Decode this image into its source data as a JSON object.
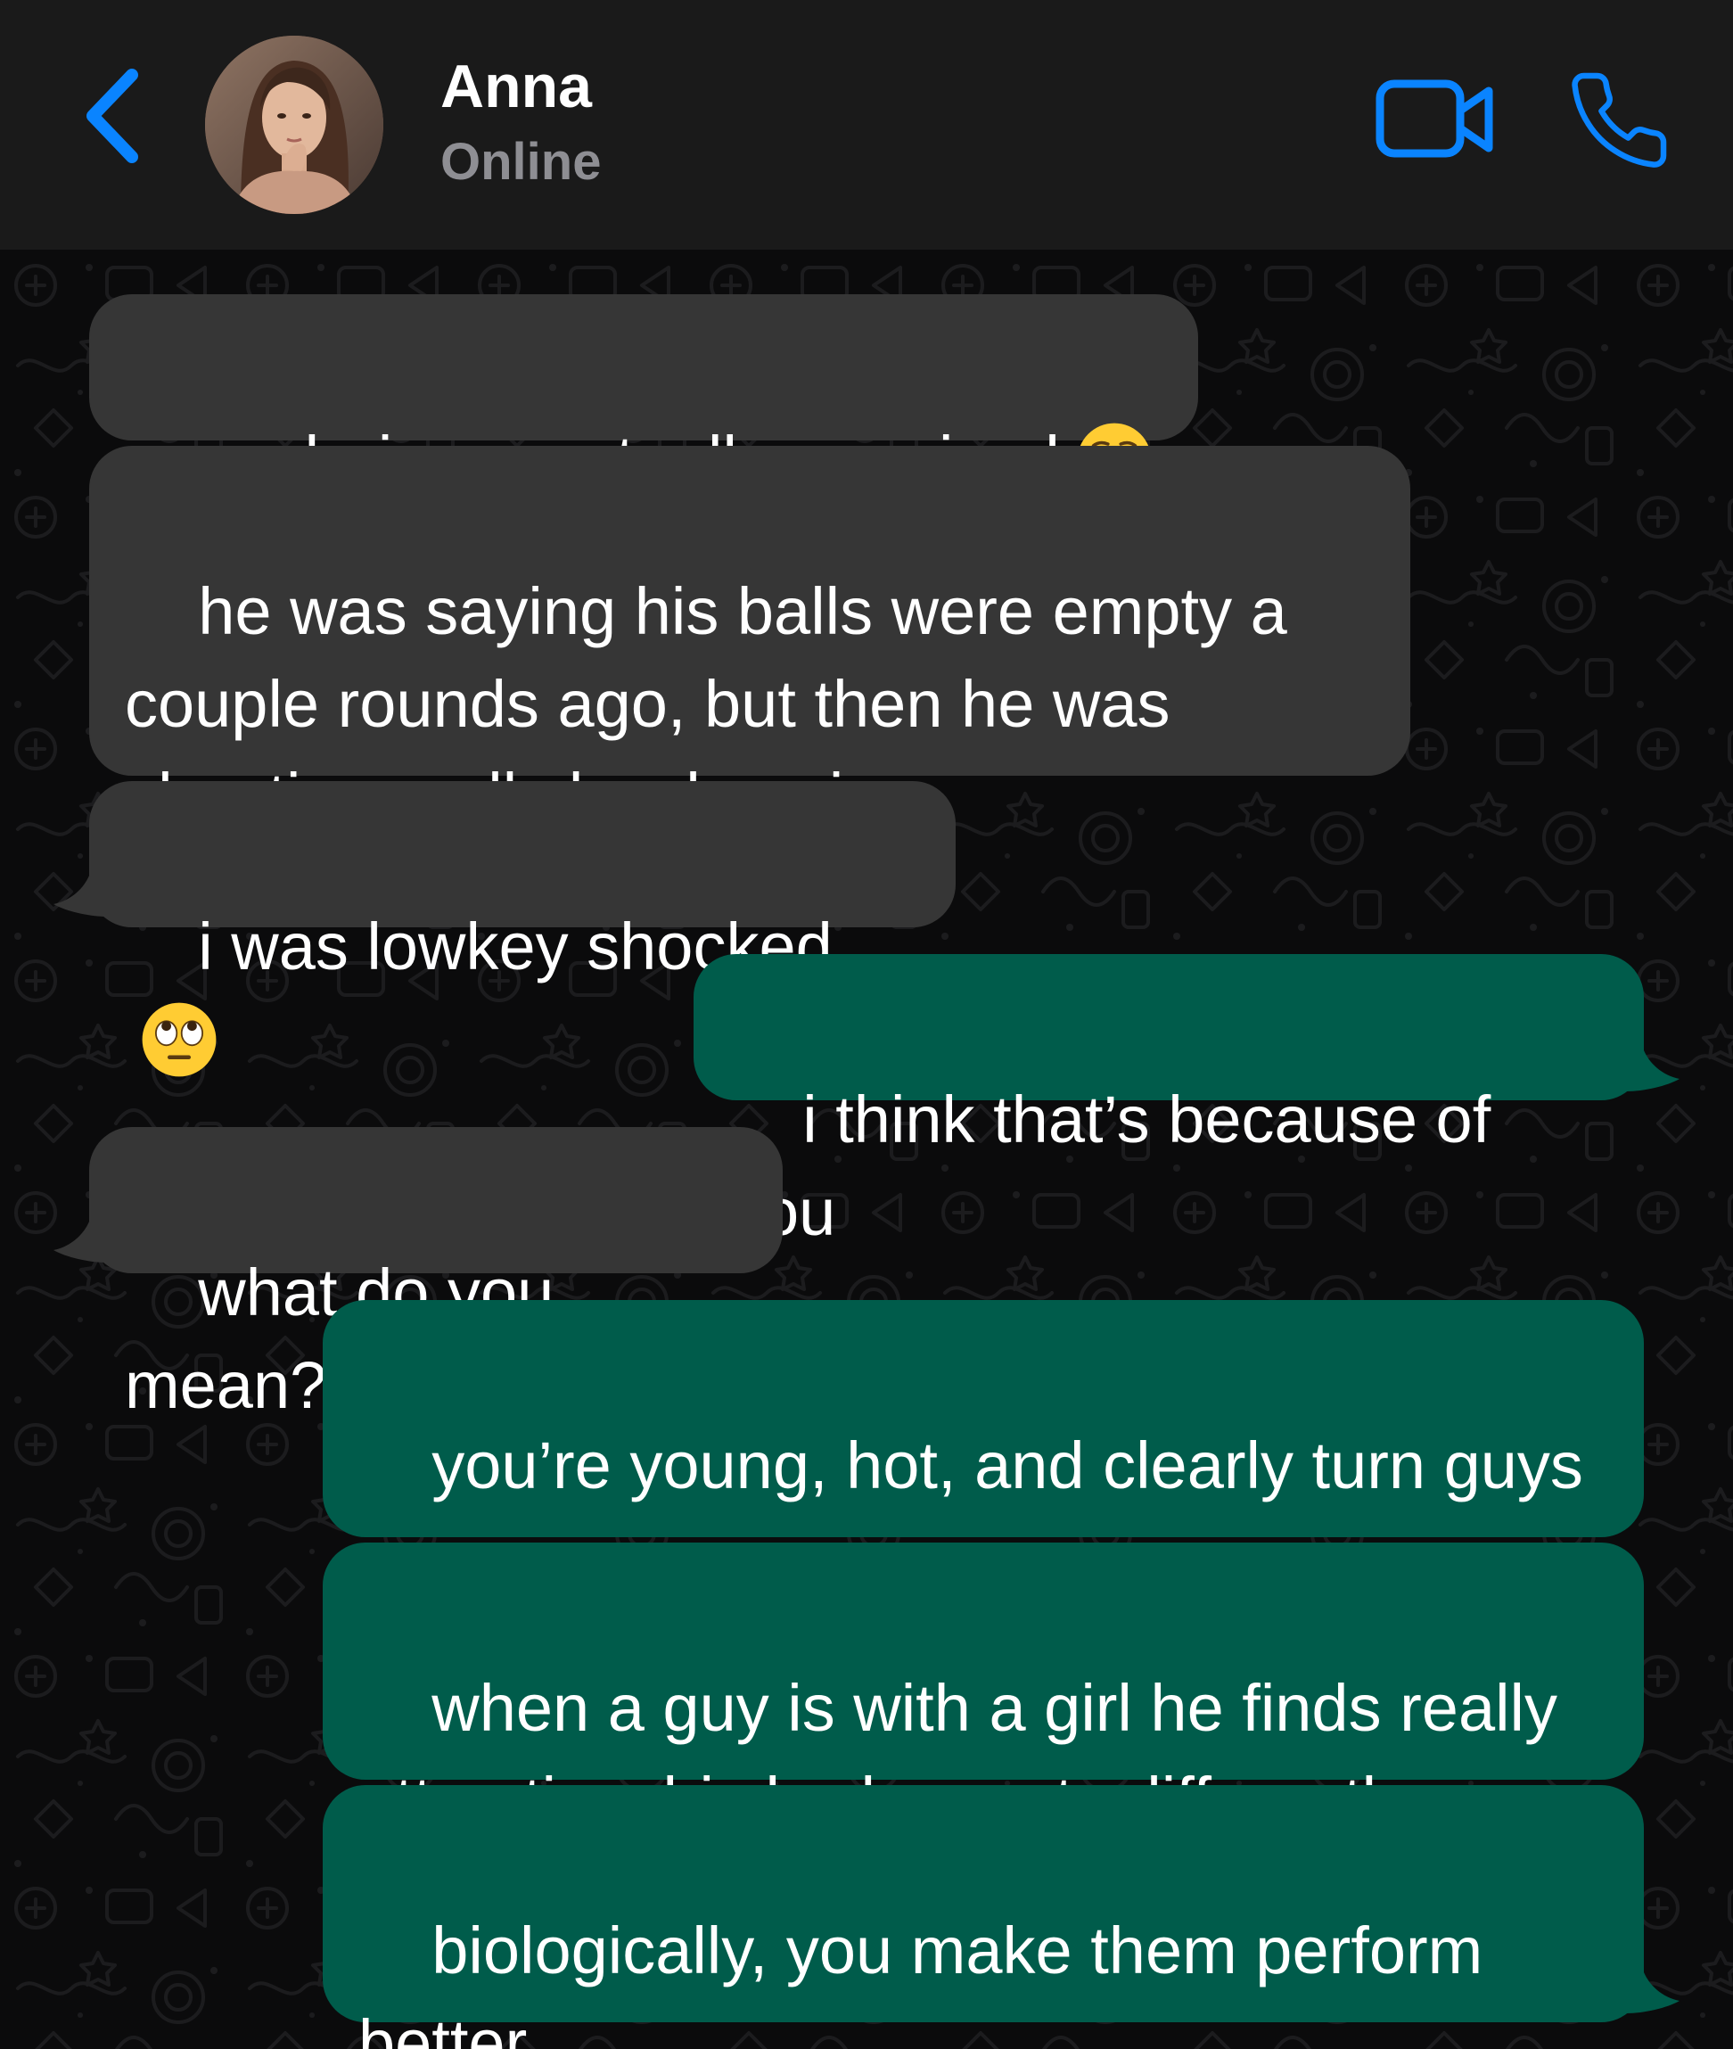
{
  "header": {
    "back_label": "Back",
    "contact_name": "Anna",
    "contact_status": "Online",
    "icons": [
      "chevron-left-icon",
      "video-camera-icon",
      "phone-icon"
    ]
  },
  "colors": {
    "accent": "#0a84ff",
    "header_bg": "#1a1a1a",
    "chat_bg": "#0b0b0c",
    "incoming_bubble": "#363636",
    "outgoing_bubble": "#005c4b",
    "status_text": "#8e8e93"
  },
  "messages": [
    {
      "direction": "incoming",
      "text": "yeah, i was actually surprised",
      "emoji": "relieved-face"
    },
    {
      "direction": "incoming",
      "text": "he was saying his balls were empty a\ncouple rounds ago, but then he was\nshooting really hard again"
    },
    {
      "direction": "incoming",
      "text": "i was lowkey shocked",
      "emoji": "eye-roll-face"
    },
    {
      "direction": "outgoing",
      "text": "i think that’s because of you"
    },
    {
      "direction": "incoming",
      "text": "what do you mean?"
    },
    {
      "direction": "outgoing",
      "text": "you’re young, hot, and clearly turn guys\non"
    },
    {
      "direction": "outgoing",
      "text": "when a guy is with a girl he finds really\nattractive, his body reacts differently"
    },
    {
      "direction": "outgoing",
      "text": "biologically, you make them perform\nbetter"
    }
  ]
}
